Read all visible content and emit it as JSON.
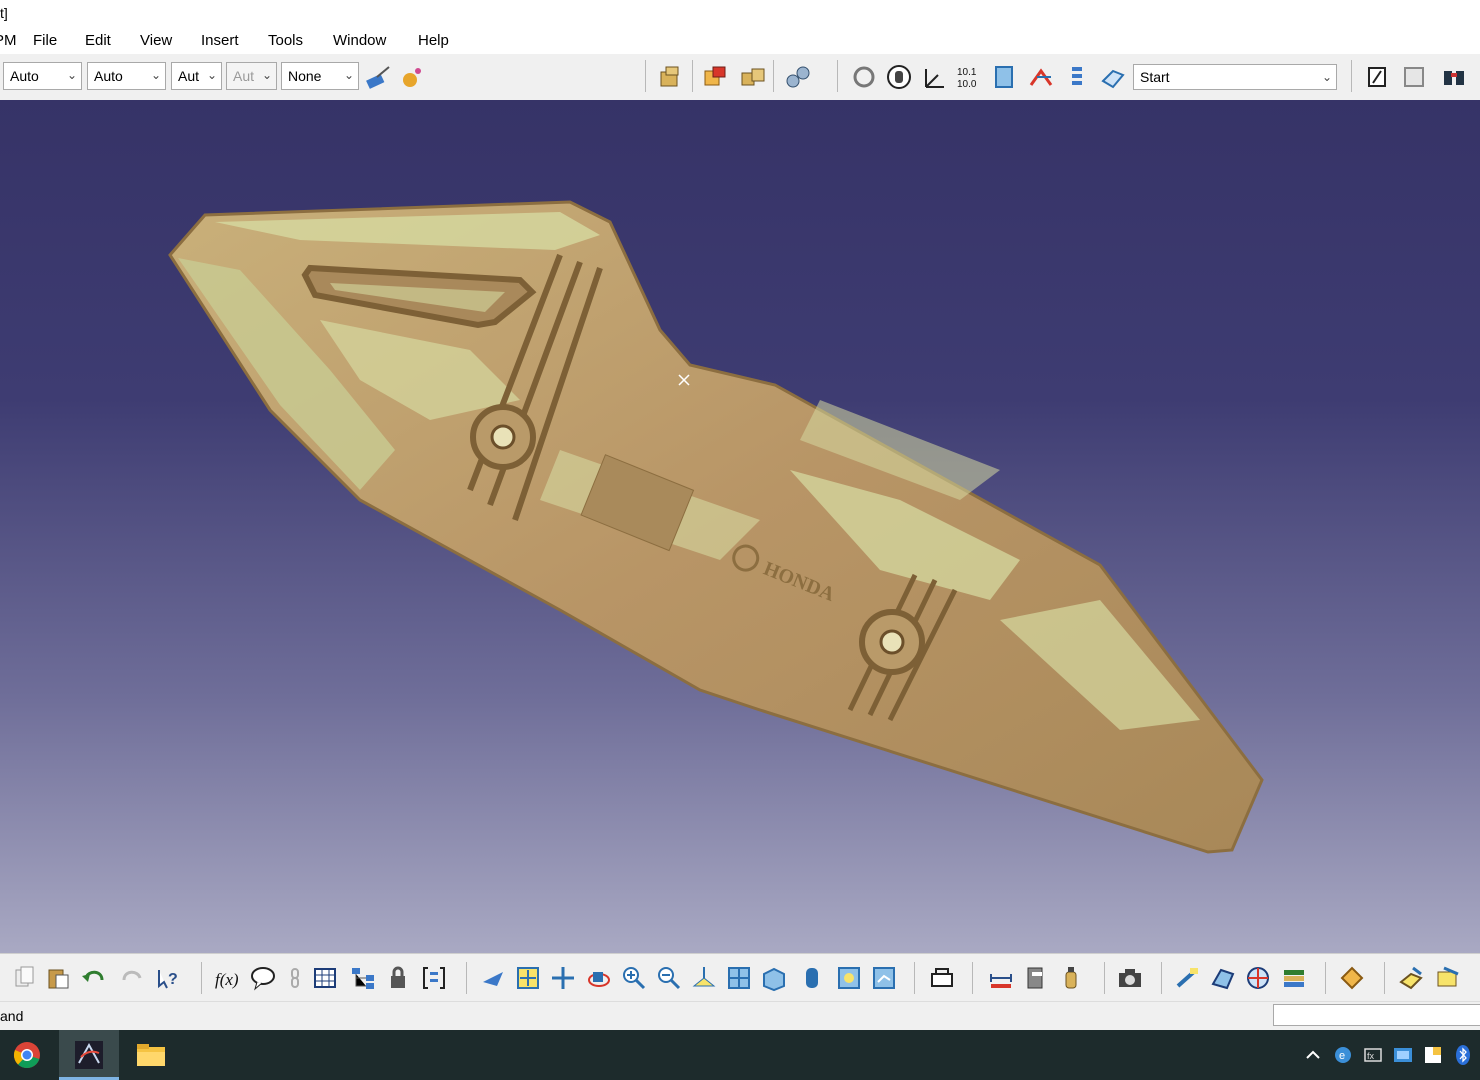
{
  "window": {
    "title_fragment": "t]"
  },
  "menu": {
    "items": [
      {
        "prefix": "",
        "underline": "",
        "label": "PM"
      },
      {
        "prefix": "",
        "underline": "F",
        "rest": "ile"
      },
      {
        "prefix": "",
        "underline": "E",
        "rest": "dit"
      },
      {
        "prefix": "",
        "underline": "V",
        "rest": "iew"
      },
      {
        "prefix": "",
        "underline": "I",
        "rest": "nsert"
      },
      {
        "prefix": "",
        "underline": "T",
        "rest": "ools"
      },
      {
        "prefix": "",
        "underline": "W",
        "rest": "indow"
      },
      {
        "prefix": "",
        "underline": "H",
        "rest": "elp"
      }
    ],
    "labels": [
      "PM",
      "File",
      "Edit",
      "View",
      "Insert",
      "Tools",
      "Window",
      "Help"
    ]
  },
  "toolbar": {
    "color_combo": "Auto",
    "transparency_combo": "Auto",
    "thickness_combo": "Aut",
    "linetype_combo": "Aut",
    "layer_combo": "None",
    "workbench_combo": "Start",
    "icons": [
      "painter-icon",
      "apply-material-icon",
      "assembly-icon",
      "product-icon",
      "components-icon",
      "constraints-icon",
      "rotate-icon",
      "pan-hand-icon",
      "axis-icon",
      "measure-numbers-icon",
      "plane-icon",
      "snap-icon",
      "list-icon",
      "layer-icon",
      "view-icon",
      "window-icon",
      "binoculars-icon"
    ]
  },
  "viewport": {
    "background_top": "#363367",
    "background_bottom": "#a9a9c3",
    "part_base_color": "#b89a6a",
    "part_highlight_color": "#d6d9a0",
    "embossed_brand": "HONDA"
  },
  "bottom_toolbar": {
    "icons": [
      "copy-icon",
      "paste-icon",
      "undo-icon",
      "redo-icon",
      "whats-this-icon",
      "formula-icon",
      "comment-icon",
      "link-icon",
      "table-icon",
      "tree-icon",
      "lock-icon",
      "data-icon",
      "fly-icon",
      "fit-all-icon",
      "pan-icon",
      "rotate-view-icon",
      "zoom-in-icon",
      "zoom-out-icon",
      "normal-view-icon",
      "multi-view-icon",
      "iso-view-icon",
      "shading-icon",
      "hide-show-icon",
      "swap-space-icon",
      "capture-icon",
      "measure-between-icon",
      "measure-item-icon",
      "measure-inertia-icon",
      "camera-icon",
      "workbench1-icon",
      "workbench2-icon",
      "workbench3-icon",
      "workbench4-icon",
      "workbench5-icon",
      "workbench6-icon",
      "workbench7-icon"
    ]
  },
  "status": {
    "text": "and",
    "input_value": ""
  },
  "taskbar": {
    "apps": [
      "chrome-icon",
      "catia-icon",
      "file-explorer-icon"
    ],
    "tray": [
      "chevron-up-icon",
      "tray-app1-icon",
      "tray-app2-icon",
      "tray-app3-icon",
      "tray-app4-icon",
      "bluetooth-icon"
    ]
  }
}
